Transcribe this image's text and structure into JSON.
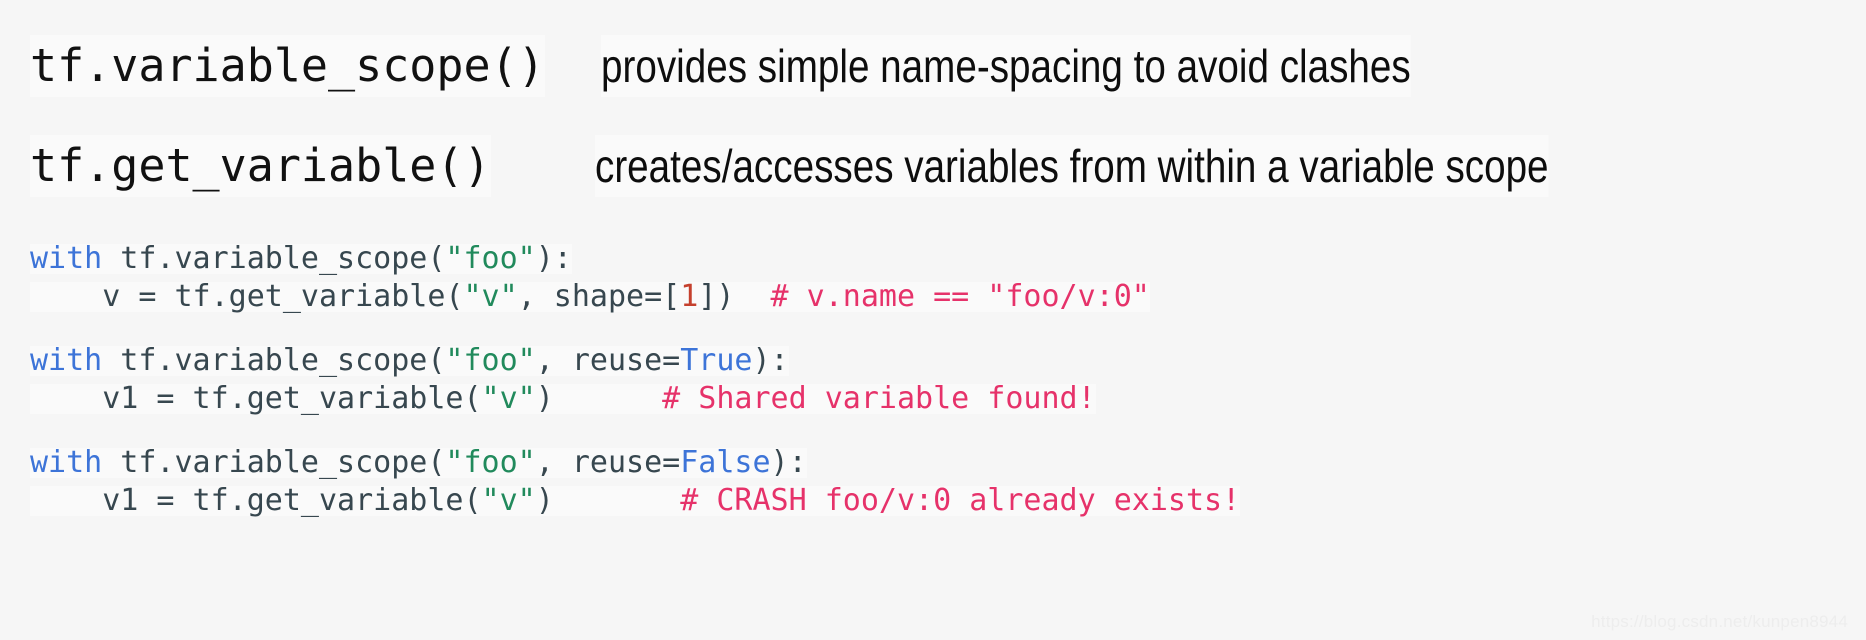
{
  "page": {
    "background_color": "#f6f6f6",
    "highlight_color": "#fafafa"
  },
  "headlines": [
    {
      "api": "tf.variable_scope()",
      "description": "provides simple name-spacing to avoid clashes"
    },
    {
      "api": "tf.get_variable()",
      "description": "creates/accesses variables from within a variable scope"
    }
  ],
  "code": {
    "palette": {
      "text": "#37474f",
      "keyword": "#3d74d8",
      "string": "#218a5c",
      "number": "#c5402d",
      "comment": "#e6326a"
    },
    "lines": [
      {
        "segments": [
          {
            "kind": "keyword",
            "text": "with"
          },
          {
            "kind": "plain",
            "text": " tf.variable_scope("
          },
          {
            "kind": "string",
            "text": "\"foo\""
          },
          {
            "kind": "plain",
            "text": "):"
          }
        ]
      },
      {
        "segments": [
          {
            "kind": "plain",
            "text": "    v = tf.get_variable("
          },
          {
            "kind": "string",
            "text": "\"v\""
          },
          {
            "kind": "plain",
            "text": ", shape=["
          },
          {
            "kind": "number",
            "text": "1"
          },
          {
            "kind": "plain",
            "text": "])  "
          },
          {
            "kind": "comment",
            "text": "# v.name == \"foo/v:0\""
          }
        ]
      },
      {
        "segments": []
      },
      {
        "segments": [
          {
            "kind": "keyword",
            "text": "with"
          },
          {
            "kind": "plain",
            "text": " tf.variable_scope("
          },
          {
            "kind": "string",
            "text": "\"foo\""
          },
          {
            "kind": "plain",
            "text": ", reuse="
          },
          {
            "kind": "keyword",
            "text": "True"
          },
          {
            "kind": "plain",
            "text": "):"
          }
        ]
      },
      {
        "segments": [
          {
            "kind": "plain",
            "text": "    v1 = tf.get_variable("
          },
          {
            "kind": "string",
            "text": "\"v\""
          },
          {
            "kind": "plain",
            "text": ")      "
          },
          {
            "kind": "comment",
            "text": "# Shared variable found!"
          }
        ]
      },
      {
        "segments": []
      },
      {
        "segments": [
          {
            "kind": "keyword",
            "text": "with"
          },
          {
            "kind": "plain",
            "text": " tf.variable_scope("
          },
          {
            "kind": "string",
            "text": "\"foo\""
          },
          {
            "kind": "plain",
            "text": ", reuse="
          },
          {
            "kind": "keyword",
            "text": "False"
          },
          {
            "kind": "plain",
            "text": "):"
          }
        ]
      },
      {
        "segments": [
          {
            "kind": "plain",
            "text": "    v1 = tf.get_variable("
          },
          {
            "kind": "string",
            "text": "\"v\""
          },
          {
            "kind": "plain",
            "text": ")       "
          },
          {
            "kind": "comment",
            "text": "# CRASH foo/v:0 already exists!"
          }
        ]
      }
    ]
  },
  "watermark": {
    "text": "https://blog.csdn.net/kunpen8944"
  }
}
